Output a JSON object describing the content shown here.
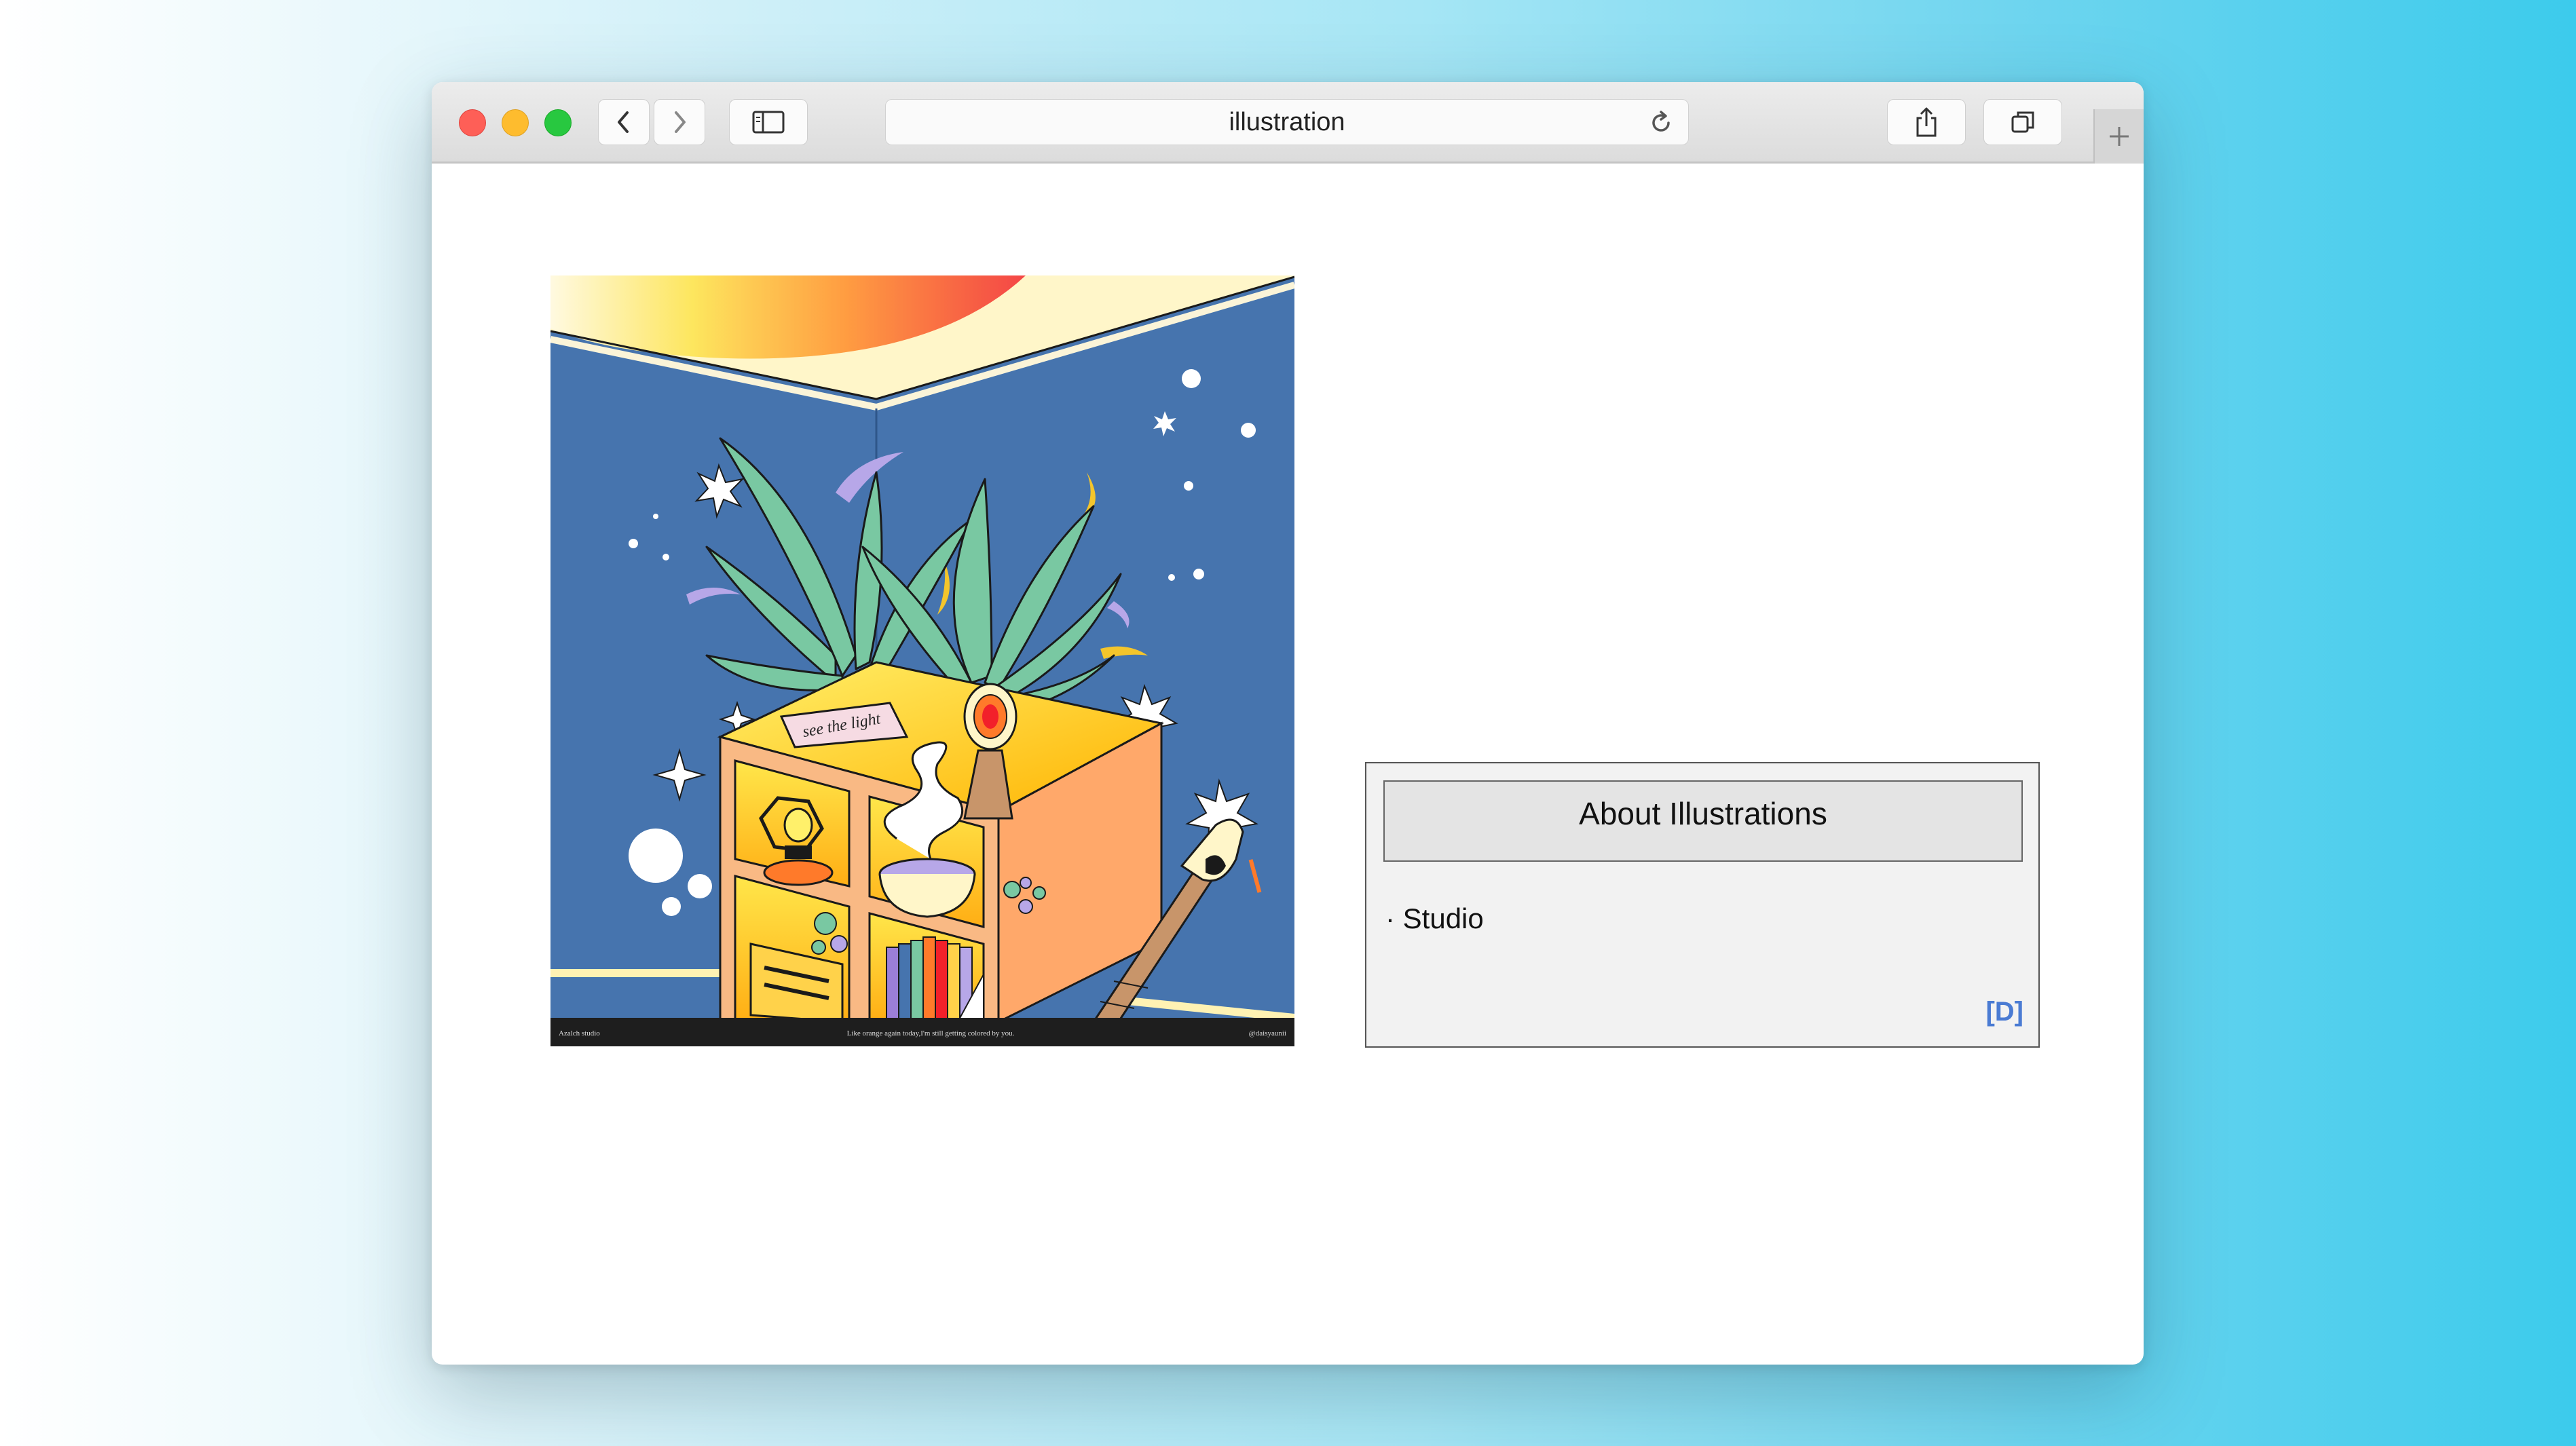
{
  "browser": {
    "url_title": "illustration",
    "icons": {
      "back": "chevron-left-icon",
      "forward": "chevron-right-icon",
      "sidebar": "sidebar-icon",
      "reload": "reload-icon",
      "share": "share-icon",
      "tabs": "tabs-icon",
      "new_tab": "plus-icon"
    }
  },
  "artwork": {
    "note_text": "see the light",
    "footer_left": "Azalch studio",
    "footer_center": "Like orange again today,I'm still getting colored by you.",
    "footer_right": "@daisyaunii"
  },
  "about": {
    "title": "About Illustrations",
    "items": [
      "· Studio"
    ],
    "link_label": "[D]",
    "link_color": "#4a7bd3"
  }
}
